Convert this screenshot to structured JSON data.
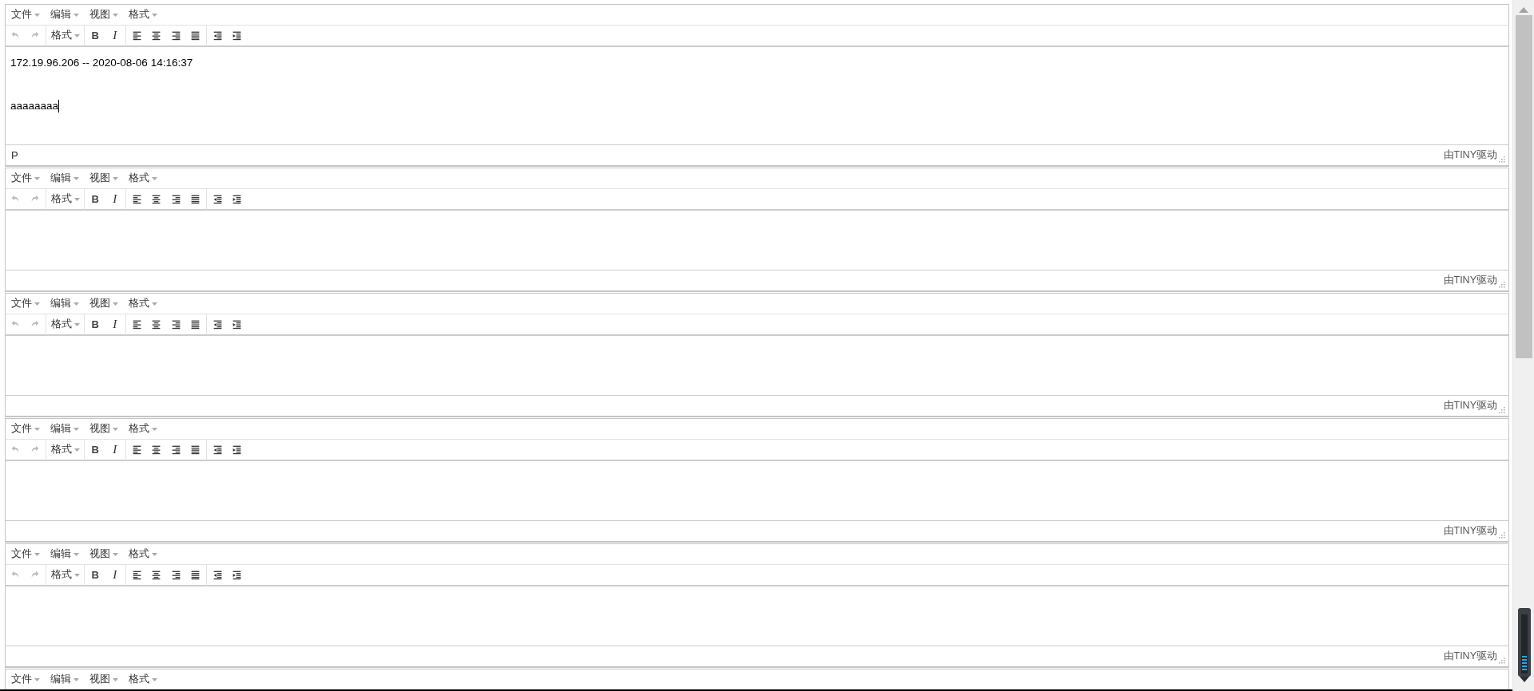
{
  "editors": [
    {
      "menus": [
        "文件",
        "编辑",
        "视图",
        "格式"
      ],
      "toolbar": [
        {
          "kind": "undo",
          "disabled": true
        },
        {
          "kind": "redo",
          "disabled": true
        },
        {
          "kind": "sep"
        },
        {
          "kind": "dropdown",
          "label": "格式"
        },
        {
          "kind": "sep"
        },
        {
          "kind": "bold",
          "label": "B"
        },
        {
          "kind": "italic",
          "label": "I"
        },
        {
          "kind": "sep"
        },
        {
          "kind": "align-left"
        },
        {
          "kind": "align-center"
        },
        {
          "kind": "align-right"
        },
        {
          "kind": "justify"
        },
        {
          "kind": "sep"
        },
        {
          "kind": "outdent"
        },
        {
          "kind": "indent"
        }
      ],
      "content": [
        {
          "text": "172.19.96.206 -- 2020-08-06 14:16:37",
          "caret": false
        },
        {
          "text": "aaaaaaaa",
          "caret": true
        }
      ],
      "path": "P",
      "branding": "由TINY驱动"
    },
    {
      "menus": [
        "文件",
        "编辑",
        "视图",
        "格式"
      ],
      "toolbar": [
        {
          "kind": "undo",
          "disabled": true
        },
        {
          "kind": "redo",
          "disabled": true
        },
        {
          "kind": "sep"
        },
        {
          "kind": "dropdown",
          "label": "格式"
        },
        {
          "kind": "sep"
        },
        {
          "kind": "bold",
          "label": "B"
        },
        {
          "kind": "italic",
          "label": "I"
        },
        {
          "kind": "sep"
        },
        {
          "kind": "align-left"
        },
        {
          "kind": "align-center"
        },
        {
          "kind": "align-right"
        },
        {
          "kind": "justify"
        },
        {
          "kind": "sep"
        },
        {
          "kind": "outdent"
        },
        {
          "kind": "indent"
        }
      ],
      "branding": "由TINY驱动"
    },
    {
      "menus": [
        "文件",
        "编辑",
        "视图",
        "格式"
      ],
      "toolbar": [
        {
          "kind": "undo",
          "disabled": true
        },
        {
          "kind": "redo",
          "disabled": true
        },
        {
          "kind": "sep"
        },
        {
          "kind": "dropdown",
          "label": "格式"
        },
        {
          "kind": "sep"
        },
        {
          "kind": "bold",
          "label": "B"
        },
        {
          "kind": "italic",
          "label": "I"
        },
        {
          "kind": "sep"
        },
        {
          "kind": "align-left"
        },
        {
          "kind": "align-center"
        },
        {
          "kind": "align-right"
        },
        {
          "kind": "justify"
        },
        {
          "kind": "sep"
        },
        {
          "kind": "outdent"
        },
        {
          "kind": "indent"
        }
      ],
      "branding": "由TINY驱动"
    },
    {
      "menus": [
        "文件",
        "编辑",
        "视图",
        "格式"
      ],
      "toolbar": [
        {
          "kind": "undo",
          "disabled": true
        },
        {
          "kind": "redo",
          "disabled": true
        },
        {
          "kind": "sep"
        },
        {
          "kind": "dropdown",
          "label": "格式"
        },
        {
          "kind": "sep"
        },
        {
          "kind": "bold",
          "label": "B"
        },
        {
          "kind": "italic",
          "label": "I"
        },
        {
          "kind": "sep"
        },
        {
          "kind": "align-left"
        },
        {
          "kind": "align-center"
        },
        {
          "kind": "align-right"
        },
        {
          "kind": "justify"
        },
        {
          "kind": "sep"
        },
        {
          "kind": "outdent"
        },
        {
          "kind": "indent"
        }
      ],
      "branding": "由TINY驱动"
    },
    {
      "menus": [
        "文件",
        "编辑",
        "视图",
        "格式"
      ],
      "toolbar": [
        {
          "kind": "undo",
          "disabled": true
        },
        {
          "kind": "redo",
          "disabled": true
        },
        {
          "kind": "sep"
        },
        {
          "kind": "dropdown",
          "label": "格式"
        },
        {
          "kind": "sep"
        },
        {
          "kind": "bold",
          "label": "B"
        },
        {
          "kind": "italic",
          "label": "I"
        },
        {
          "kind": "sep"
        },
        {
          "kind": "align-left"
        },
        {
          "kind": "align-center"
        },
        {
          "kind": "align-right"
        },
        {
          "kind": "justify"
        },
        {
          "kind": "sep"
        },
        {
          "kind": "outdent"
        },
        {
          "kind": "indent"
        }
      ],
      "branding": "由TINY驱动"
    },
    {
      "menus": [
        "文件",
        "编辑",
        "视图",
        "格式"
      ]
    }
  ]
}
